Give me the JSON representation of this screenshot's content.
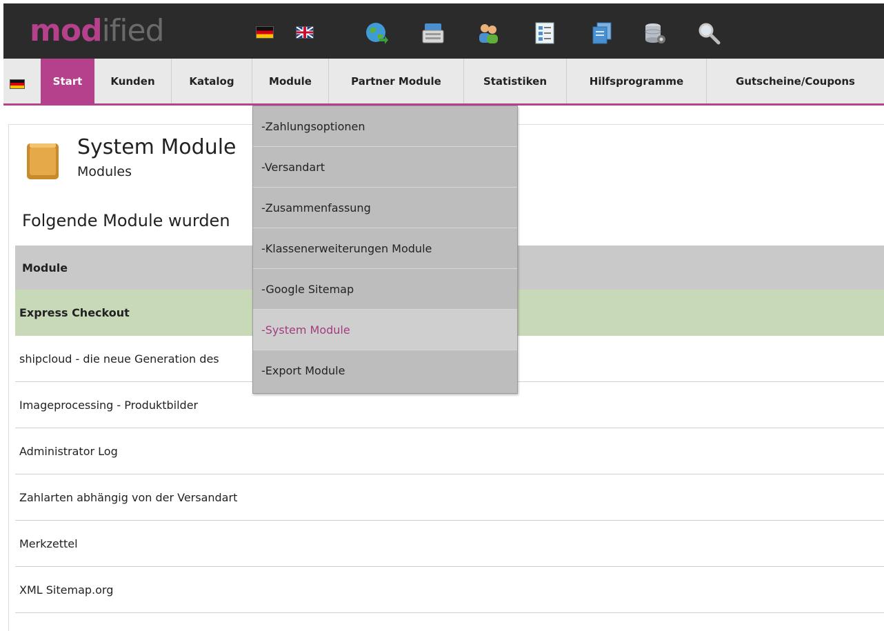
{
  "logo": {
    "part_a": "mod",
    "part_b": "ified"
  },
  "topbar": {
    "icons": [
      "german-flag-icon",
      "uk-flag-icon",
      "globe-icon",
      "cash-register-icon",
      "users-icon",
      "form-icon",
      "documents-icon",
      "database-settings-icon",
      "search-icon"
    ]
  },
  "nav": {
    "items": [
      {
        "label": "Start"
      },
      {
        "label": "Kunden"
      },
      {
        "label": "Katalog"
      },
      {
        "label": "Module"
      },
      {
        "label": "Partner Module"
      },
      {
        "label": "Statistiken"
      },
      {
        "label": "Hilfsprogramme"
      },
      {
        "label": "Gutscheine/Coupons"
      }
    ]
  },
  "page": {
    "title": "System Module",
    "subtitle": "Modules",
    "notice": "Folgende Module wurden"
  },
  "table": {
    "header": "Module",
    "selected": "Express Checkout",
    "rows": [
      "shipcloud - die neue Generation des",
      "Imageprocessing - Produktbilder",
      "Administrator Log",
      "Zahlarten abhängig von der Versandart",
      "Merkzettel",
      "XML Sitemap.org"
    ]
  },
  "dropdown": {
    "items": [
      "-Zahlungsoptionen",
      "-Versandart",
      "-Zusammenfassung",
      "-Klassenerweiterungen Module",
      "-Google Sitemap",
      "-System Module",
      "-Export Module"
    ]
  },
  "colors": {
    "brand": "#b5408c",
    "topbar": "#2b2b2b",
    "selected_row": "#c8d9b8"
  }
}
